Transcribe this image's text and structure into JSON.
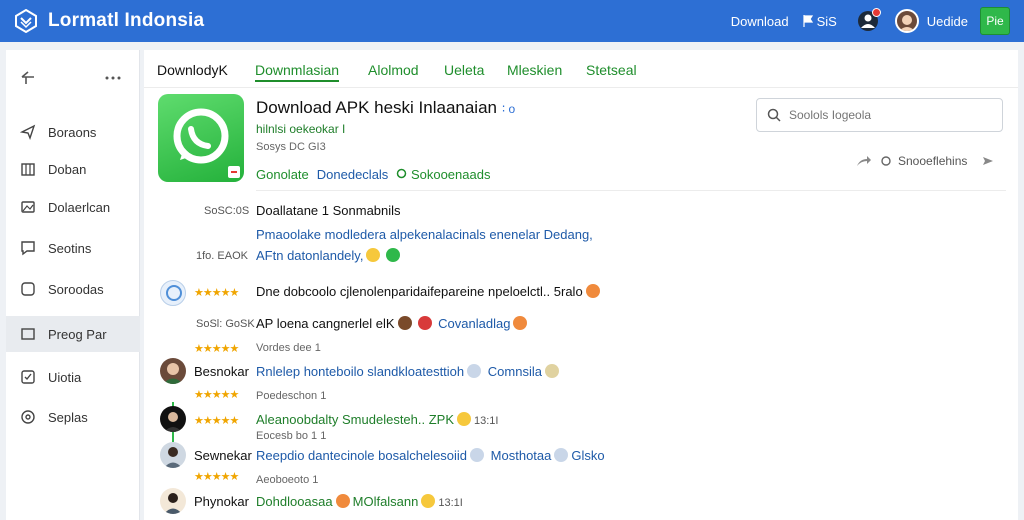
{
  "header": {
    "brand": "Lormatl Indonsia",
    "download_link": "Download",
    "count": "SiS",
    "user_name": "Uedide",
    "button_label": "Pie",
    "brand_color": "#2d6fd4"
  },
  "sidebar": {
    "items": [
      {
        "label": "Boraons",
        "icon": "send-icon"
      },
      {
        "label": "Doban",
        "icon": "grid-icon"
      },
      {
        "label": "Dolaerlcan",
        "icon": "image-icon"
      },
      {
        "label": "Seotins",
        "icon": "chat-icon"
      },
      {
        "label": "Soroodas",
        "icon": "comment-icon"
      },
      {
        "label": "Preog Par",
        "icon": "folder-icon"
      },
      {
        "label": "Uiotia",
        "icon": "checkbox-icon"
      },
      {
        "label": "Seplas",
        "icon": "settings-icon"
      }
    ]
  },
  "tabs": [
    {
      "label": "DownlodyK"
    },
    {
      "label": "Downmlasian"
    },
    {
      "label": "Alolmod"
    },
    {
      "label": "Ueleta"
    },
    {
      "label": "Mleskien"
    },
    {
      "label": "Stetseal"
    }
  ],
  "app": {
    "title": "Download APK heski Inlaanaian",
    "title_badge": "∶ o",
    "subtitle": "hilnlsi oekeokar I",
    "meta": "Sosys DC GI3",
    "links": [
      "Gonolate",
      "Donedeclals",
      "Sokooenaads"
    ],
    "accent_green": "#1f8e2c"
  },
  "search": {
    "placeholder": "Soolols Iogeola"
  },
  "share": {
    "label": "Snooeflehins"
  },
  "feed": [
    {
      "time": "SoSC:0S",
      "text": "Doallatane 1 Sonmabnils"
    },
    {
      "time": "",
      "text": "Pmaoolake modledera alpekenalacinals enenelar Dedang,"
    },
    {
      "time": "1fo. EAOK",
      "text": "AFtn datonlandely,"
    },
    {
      "time": "",
      "text": "Dne dobcoolo cjlenolenparidaifepareine npeloelctl.. 5ralo",
      "stars": "★★★★★"
    },
    {
      "time": "SoSl: GoSK",
      "text": "AP loena cangnerlel elK",
      "extra": "Covanladlag"
    },
    {
      "time": "",
      "sub": "Vordes dee 1",
      "stars": "★★★★★"
    },
    {
      "name": "Besnokar",
      "text": "Rnlelep honteboilo slandkloatesttioh",
      "extra": "Comnsila"
    },
    {
      "sub": "Poedeschon 1",
      "stars": "★★★★★"
    },
    {
      "text": "Aleanoobdalty Smudelesteh.. ZPK",
      "extra": "13:1I",
      "stars": "★★★★★"
    },
    {
      "sub": "Eocesb bo 1 1"
    },
    {
      "name": "Sewnekar",
      "text": "Reepdio dantecinole bosalchelesoiid",
      "extra": "Mosthotaa",
      "extra2": "Glsko"
    },
    {
      "sub": "Aeoboeoto 1",
      "stars": "★★★★★"
    },
    {
      "name": "Phynokar",
      "text": "Dohdlooasaa",
      "extra": "MOlfalsann",
      "extra2": "13:1I"
    }
  ]
}
